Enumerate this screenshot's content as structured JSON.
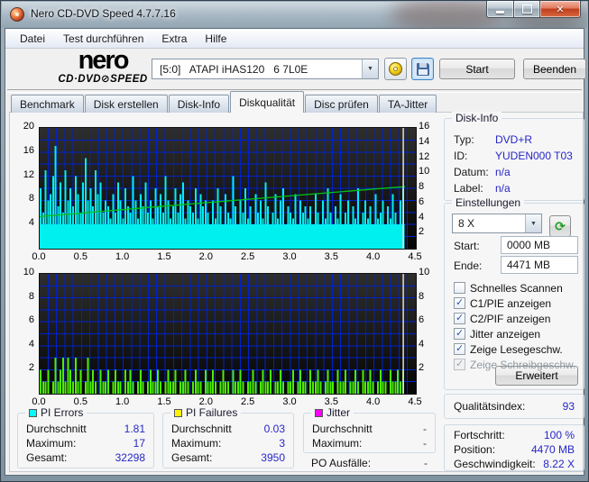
{
  "window": {
    "title": "Nero CD-DVD Speed 4.7.7.16",
    "caption_buttons": [
      "minimize-icon",
      "maximize-icon",
      "close-icon"
    ]
  },
  "menu": {
    "items": [
      "Datei",
      "Test durchführen",
      "Extra",
      "Hilfe"
    ]
  },
  "logo": {
    "line1": "nero",
    "line2": "CD·DVD⊘SPEED"
  },
  "toolbar": {
    "drive_select": "[5:0]   ATAPI iHAS120   6 7L0E",
    "icons": [
      "eject-disc-icon",
      "save-icon"
    ],
    "start_button": "Start",
    "quit_button": "Beenden"
  },
  "tabs": {
    "active_index": 3,
    "items": [
      "Benchmark",
      "Disk erstellen",
      "Disk-Info",
      "Diskqualität",
      "Disc prüfen",
      "TA-Jitter"
    ]
  },
  "disk_info": {
    "title": "Disk-Info",
    "rows": [
      {
        "label": "Typ:",
        "value": "DVD+R"
      },
      {
        "label": "ID:",
        "value": "YUDEN000 T03"
      },
      {
        "label": "Datum:",
        "value": "n/a"
      },
      {
        "label": "Label:",
        "value": "n/a"
      }
    ]
  },
  "settings": {
    "title": "Einstellungen",
    "speed_select": "8 X",
    "refresh_icon": "refresh-icon",
    "start_label": "Start:",
    "start_value": "0000 MB",
    "end_label": "Ende:",
    "end_value": "4471 MB",
    "checkboxes": [
      {
        "label": "Schnelles Scannen",
        "checked": false,
        "disabled": false
      },
      {
        "label": "C1/PIE anzeigen",
        "checked": true,
        "disabled": false
      },
      {
        "label": "C2/PIF anzeigen",
        "checked": true,
        "disabled": false
      },
      {
        "label": "Jitter anzeigen",
        "checked": true,
        "disabled": false
      },
      {
        "label": "Zeige Lesegeschw.",
        "checked": true,
        "disabled": false
      },
      {
        "label": "Zeige Schreibgeschw.",
        "checked": true,
        "disabled": true
      }
    ],
    "advanced_button": "Erweitert"
  },
  "quality": {
    "label": "Qualitätsindex:",
    "value": "93"
  },
  "progress": {
    "rows": [
      {
        "label": "Fortschritt:",
        "value": "100 %"
      },
      {
        "label": "Position:",
        "value": "4470 MB"
      },
      {
        "label": "Geschwindigkeit:",
        "value": "8.22 X"
      }
    ]
  },
  "stats": {
    "pi_errors": {
      "title": "PI Errors",
      "legend_color": "#00ffff",
      "rows": [
        {
          "label": "Durchschnitt",
          "value": "1.81"
        },
        {
          "label": "Maximum:",
          "value": "17"
        },
        {
          "label": "Gesamt:",
          "value": "32298"
        }
      ]
    },
    "pi_failures": {
      "title": "PI Failures",
      "legend_color": "#fff200",
      "rows": [
        {
          "label": "Durchschnitt",
          "value": "0.03"
        },
        {
          "label": "Maximum:",
          "value": "3"
        },
        {
          "label": "Gesamt:",
          "value": "3950"
        }
      ]
    },
    "jitter": {
      "title": "Jitter",
      "legend_color": "#ff00ff",
      "rows": [
        {
          "label": "Durchschnitt",
          "value": "-"
        },
        {
          "label": "Maximum:",
          "value": "-"
        }
      ],
      "extra_row": {
        "label": "PO Ausfälle:",
        "value": "-"
      }
    }
  },
  "chart_data": [
    {
      "type": "bar",
      "name": "pi-errors",
      "series": "PI Errors",
      "x_unit": "GB",
      "x_start": 0,
      "x_step": 0.0299,
      "xlim": [
        0,
        4.5
      ],
      "x_ticks": [
        "0.0",
        "0.5",
        "1.0",
        "1.5",
        "2.0",
        "2.5",
        "3.0",
        "3.5",
        "4.0",
        "4.5"
      ],
      "left_max": 20,
      "left_ticks": [
        20,
        16,
        12,
        8,
        4
      ],
      "right_max": 16,
      "right_ticks": [
        16,
        14,
        12,
        10,
        8,
        6,
        4,
        2
      ],
      "grid_rows": 10,
      "grid_x_step": 0.1,
      "grid_color": "#0021cc",
      "bar_color": "#00f0f0",
      "base_value": 4,
      "values": [
        10,
        6,
        13,
        8,
        9,
        12,
        17,
        7,
        11,
        6,
        13,
        8,
        10,
        7,
        12,
        9,
        6,
        11,
        15,
        8,
        10,
        7,
        13,
        9,
        11,
        6,
        8,
        7,
        5,
        9,
        6,
        11,
        8,
        5,
        10,
        7,
        6,
        12,
        8,
        5,
        9,
        7,
        11,
        6,
        8,
        5,
        10,
        7,
        9,
        6,
        12,
        8,
        5,
        7,
        10,
        6,
        9,
        11,
        5,
        8,
        7,
        6,
        10,
        5,
        9,
        7,
        8,
        6,
        4,
        8,
        5,
        10,
        7,
        4,
        9,
        6,
        5,
        12,
        7,
        4,
        8,
        6,
        10,
        5,
        7,
        4,
        9,
        6,
        8,
        5,
        11,
        7,
        4,
        6,
        9,
        5,
        8,
        10,
        4,
        7,
        6,
        5,
        9,
        4,
        8,
        6,
        7,
        5,
        7,
        4,
        9,
        6,
        4,
        8,
        5,
        10,
        6,
        4,
        7,
        5,
        9,
        4,
        6,
        8,
        4,
        7,
        5,
        10,
        4,
        6,
        8,
        5,
        7,
        4,
        9,
        5,
        6,
        8,
        4,
        7,
        5,
        9,
        6,
        4,
        8,
        10
      ],
      "line": {
        "name": "read-speed-x",
        "color": "#00c414",
        "x": [
          0,
          0.5,
          1.0,
          1.5,
          2.0,
          2.5,
          3.0,
          3.5,
          4.0,
          4.37
        ],
        "y": [
          4.25,
          4.72,
          5.18,
          5.65,
          6.1,
          6.55,
          7.0,
          7.45,
          7.9,
          8.22
        ]
      },
      "marker_x": 4.35,
      "marker_color": "#dedede"
    },
    {
      "type": "bar",
      "name": "pi-failures",
      "series": "PI Failures",
      "x_unit": "GB",
      "x_start": 0,
      "x_step": 0.0299,
      "xlim": [
        0,
        4.5
      ],
      "x_ticks": [
        "0.0",
        "0.5",
        "1.0",
        "1.5",
        "2.0",
        "2.5",
        "3.0",
        "3.5",
        "4.0",
        "4.5"
      ],
      "left_max": 10,
      "left_ticks": [
        10,
        8,
        6,
        4,
        2
      ],
      "right_max": 10,
      "right_ticks": [
        10,
        8,
        6,
        4,
        2
      ],
      "grid_rows": 10,
      "grid_x_step": 0.1,
      "grid_color": "#0021cc",
      "bar_color": "#4cf000",
      "base_value": 0,
      "values": [
        2,
        1,
        1,
        2,
        0,
        1,
        3,
        1,
        2,
        3,
        1,
        3,
        2,
        1,
        3,
        1,
        2,
        0,
        1,
        3,
        1,
        2,
        1,
        0,
        2,
        1,
        1,
        2,
        0,
        1,
        2,
        1,
        1,
        0,
        2,
        1,
        2,
        1,
        0,
        1,
        2,
        1,
        0,
        1,
        2,
        1,
        1,
        2,
        1,
        0,
        1,
        2,
        1,
        1,
        2,
        0,
        1,
        1,
        2,
        1,
        0,
        1,
        2,
        1,
        1,
        0,
        2,
        1,
        1,
        2,
        1,
        0,
        1,
        2,
        1,
        1,
        0,
        2,
        1,
        1,
        2,
        1,
        0,
        1,
        1,
        2,
        1,
        0,
        1,
        2,
        1,
        1,
        2,
        0,
        1,
        1,
        2,
        1,
        0,
        1,
        1,
        2,
        0,
        1,
        2,
        1,
        1,
        0,
        2,
        1,
        1,
        2,
        1,
        0,
        1,
        2,
        1,
        1,
        0,
        2,
        1,
        1,
        2,
        0,
        1,
        1,
        2,
        1,
        0,
        2,
        1,
        1,
        2,
        1,
        0,
        1,
        2,
        1,
        1,
        0,
        2,
        1,
        1,
        2,
        1,
        2
      ],
      "marker_x": 4.35,
      "marker_color": "#dedede"
    }
  ]
}
